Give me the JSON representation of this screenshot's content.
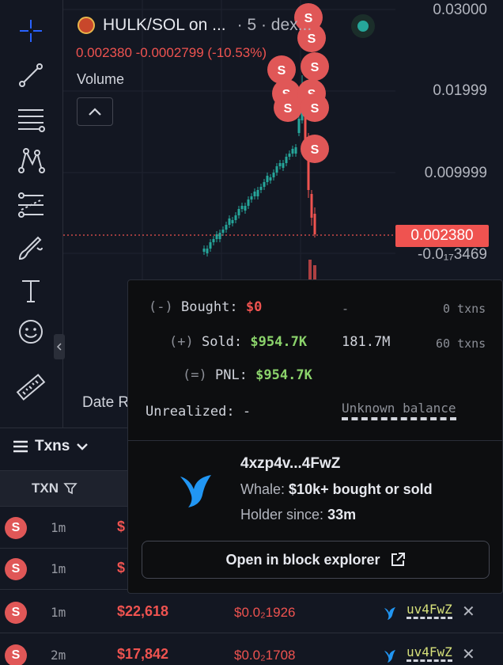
{
  "chart": {
    "pair_title": "HULK/SOL on ...",
    "timeframe": "· 5 · dex...",
    "price": "0.002380",
    "change": "-0.0002799 (-10.53%)",
    "volume_label": "Volume",
    "axis_labels": [
      "0.03000",
      "0.01999",
      "0.009999",
      "-0.0₁₇3469"
    ],
    "last_price": "0.002380",
    "date_range_label": "Date R",
    "sell_marker_letter": "S"
  },
  "txns_tab": {
    "label": "Txns",
    "col_txn": "TXN"
  },
  "rows": [
    {
      "type": "S",
      "age": "1m",
      "usd": "$",
      "price": "",
      "maker": ""
    },
    {
      "type": "S",
      "age": "1m",
      "usd": "$",
      "price": "",
      "maker": ""
    },
    {
      "type": "S",
      "age": "1m",
      "usd": "$22,618",
      "price": "$0.0₂1926",
      "maker": "uv4FwZ"
    },
    {
      "type": "S",
      "age": "2m",
      "usd": "$17,842",
      "price": "$0.0₂1708",
      "maker": "uv4FwZ"
    }
  ],
  "popover": {
    "bought_prefix": "(-)",
    "bought_label": "Bought:",
    "bought_value": "$0",
    "bought_amount": "-",
    "bought_txns": "0 txns",
    "sold_prefix": "(+)",
    "sold_label": "Sold:",
    "sold_value": "$954.7K",
    "sold_amount": "181.7M",
    "sold_txns": "60 txns",
    "pnl_prefix": "(=)",
    "pnl_label": "PNL:",
    "pnl_value": "$954.7K",
    "unrealized_label": "Unrealized:",
    "unrealized_value": "-",
    "unknown_balance": "Unknown balance",
    "wallet": "4xzp4v...4FwZ",
    "whale_prefix": "Whale:",
    "whale_value": "$10k+ bought or sold",
    "holder_prefix": "Holder since:",
    "holder_value": "33m",
    "explorer_label": "Open in block explorer"
  },
  "colors": {
    "up": "#26a69a",
    "down": "#ef5350",
    "whale": "#2196f3",
    "sell_badge": "#e05757"
  },
  "icons": [
    "crosshair-icon",
    "trend-line-icon",
    "fib-icon",
    "pattern-icon",
    "forecast-icon",
    "brush-icon",
    "text-icon",
    "emoji-icon",
    "ruler-icon",
    "chevron-down-icon",
    "filter-icon",
    "whale-icon",
    "external-link-icon",
    "close-icon",
    "chevron-up-icon",
    "chevron-left-icon"
  ]
}
